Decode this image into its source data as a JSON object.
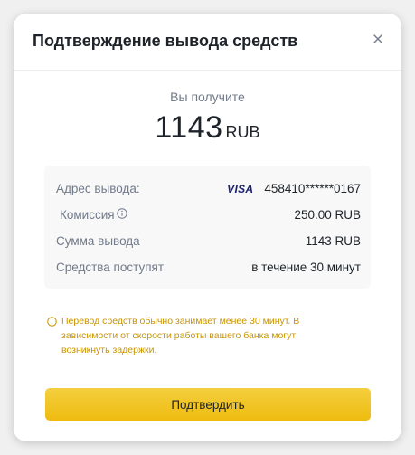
{
  "dialog": {
    "title": "Подтверждение вывода средств"
  },
  "summary": {
    "receive_label": "Вы получите",
    "amount": "1143",
    "currency": "RUB"
  },
  "details": {
    "rows": [
      {
        "label": "Адрес вывода:",
        "value": "458410******0167",
        "card_brand": "VISA"
      },
      {
        "label": "Комиссия",
        "value": "250.00 RUB"
      },
      {
        "label": "Сумма вывода",
        "value": "1143 RUB"
      },
      {
        "label": "Средства поступят",
        "value": "в течение 30 минут"
      }
    ]
  },
  "notice": {
    "text": "Перевод средств обычно занимает менее 30 минут. В зависимости от скорости работы вашего банка могут возникнуть задержки."
  },
  "actions": {
    "confirm_label": "Подтвердить"
  },
  "colors": {
    "accent": "#F0B90B",
    "notice": "#C99400",
    "text_primary": "#1E2329",
    "text_secondary": "#707A8A"
  },
  "icons": {
    "close": "close-icon",
    "fee_info": "info-icon",
    "notice": "info-icon"
  }
}
